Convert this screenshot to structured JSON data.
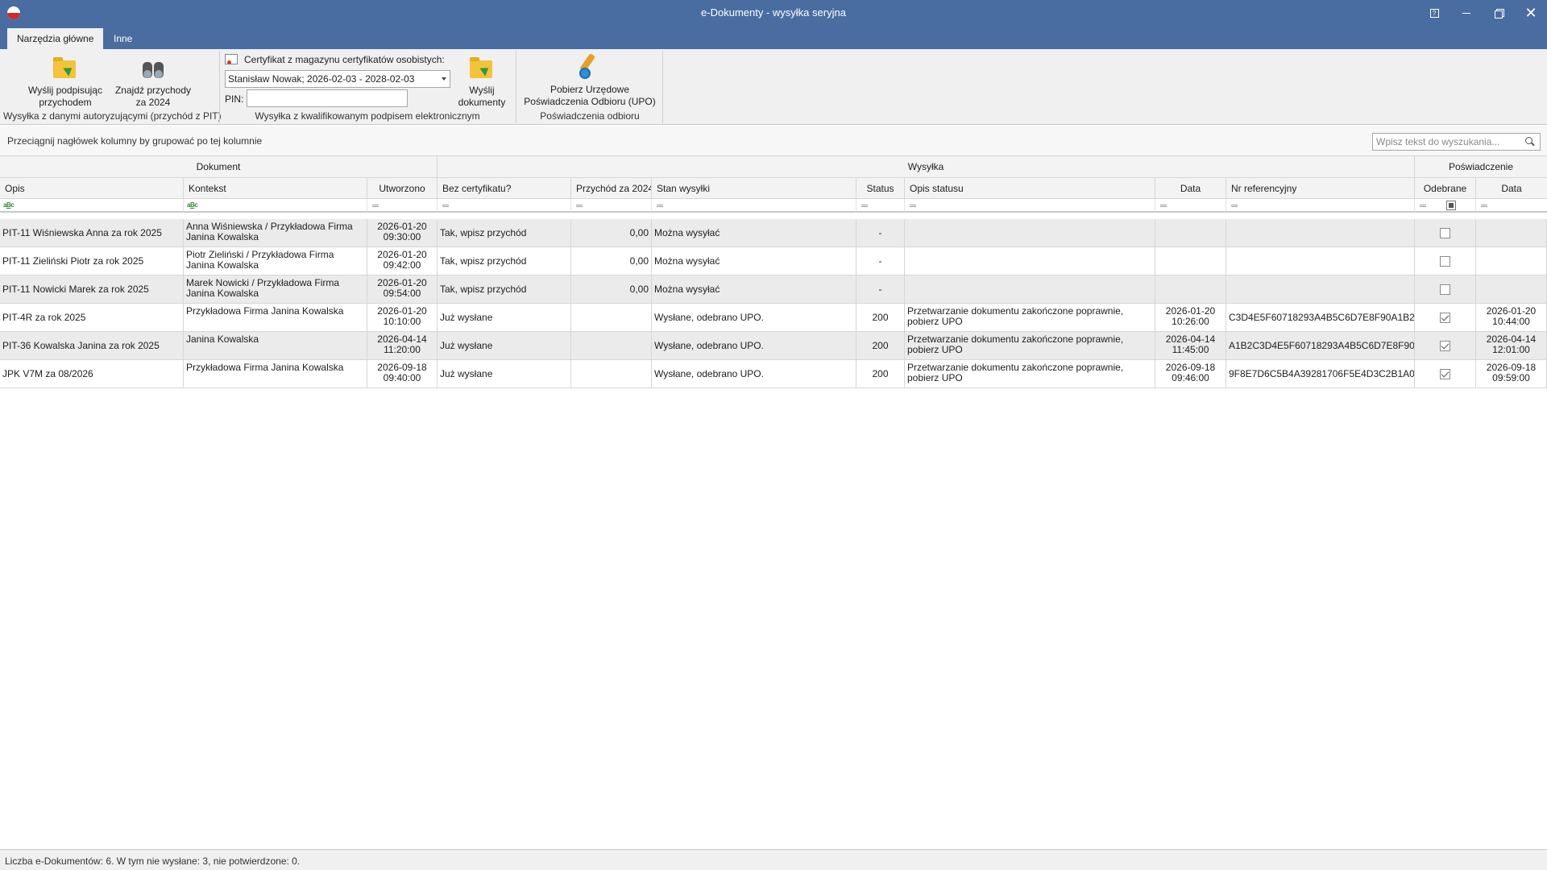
{
  "window": {
    "title": "e-Dokumenty - wysyłka seryjna",
    "help_label": "?",
    "close_label": "✕"
  },
  "tabs": [
    {
      "label": "Narzędzia główne"
    },
    {
      "label": "Inne"
    }
  ],
  "ribbon": {
    "btn_send_income_l1": "Wyślij podpisując",
    "btn_send_income_l2": "przychodem",
    "btn_find_income_l1": "Znajdź przychody",
    "btn_find_income_l2": "za 2024",
    "group1_label": "Wysyłka z danymi autoryzującymi (przychód z PIT)",
    "cert_label": "Certyfikat z magazynu certyfikatów osobistych:",
    "cert_value": "Stanisław Nowak; 2026-02-03 - 2028-02-03",
    "pin_label": "PIN:",
    "btn_send_docs_l1": "Wyślij",
    "btn_send_docs_l2": "dokumenty",
    "group2_label": "Wysyłka z kwalifikowanym podpisem elektronicznym",
    "btn_upo_l1": "Pobierz Urzędowe",
    "btn_upo_l2": "Poświadczenia Odbioru (UPO)",
    "group3_label": "Poświadczenia odbioru"
  },
  "groupbar": {
    "hint": "Przeciągnij nagłówek kolumny by grupować po tej kolumnie",
    "search_placeholder": "Wpisz tekst do wyszukania..."
  },
  "grid": {
    "bands": {
      "dokument": "Dokument",
      "wysylka": "Wysyłka",
      "poswiadczenie": "Poświadczenie"
    },
    "columns": {
      "opis": "Opis",
      "kontekst": "Kontekst",
      "utworzono": "Utworzono",
      "bez_cert": "Bez certyfikatu?",
      "przychod": "Przychód za 2024",
      "stan": "Stan wysyłki",
      "status": "Status",
      "opis_statusu": "Opis statusu",
      "data": "Data",
      "nr_ref": "Nr referencyjny",
      "odebrane": "Odebrane",
      "data_upo": "Data"
    },
    "rows": [
      {
        "opis": "PIT-11 Wiśniewska Anna za rok 2025",
        "kontekst": "Anna Wiśniewska / Przykładowa Firma Janina Kowalska",
        "utw_date": "2026-01-20",
        "utw_time": "09:30:00",
        "bez_cert": "Tak, wpisz przychód",
        "przychod": "0,00",
        "stan": "Można wysyłać",
        "status": "-",
        "opis_statusu": "",
        "data_date": "",
        "data_time": "",
        "nr_ref": "",
        "odebrane": false,
        "upo_date": "",
        "upo_time": ""
      },
      {
        "opis": "PIT-11 Zieliński Piotr za rok 2025",
        "kontekst": "Piotr Zieliński / Przykładowa Firma Janina Kowalska",
        "utw_date": "2026-01-20",
        "utw_time": "09:42:00",
        "bez_cert": "Tak, wpisz przychód",
        "przychod": "0,00",
        "stan": "Można wysyłać",
        "status": "-",
        "opis_statusu": "",
        "data_date": "",
        "data_time": "",
        "nr_ref": "",
        "odebrane": false,
        "upo_date": "",
        "upo_time": ""
      },
      {
        "opis": "PIT-11 Nowicki Marek za rok 2025",
        "kontekst": "Marek Nowicki / Przykładowa Firma Janina Kowalska",
        "utw_date": "2026-01-20",
        "utw_time": "09:54:00",
        "bez_cert": "Tak, wpisz przychód",
        "przychod": "0,00",
        "stan": "Można wysyłać",
        "status": "-",
        "opis_statusu": "",
        "data_date": "",
        "data_time": "",
        "nr_ref": "",
        "odebrane": false,
        "upo_date": "",
        "upo_time": ""
      },
      {
        "opis": "PIT-4R za rok 2025",
        "kontekst": "Przykładowa Firma Janina Kowalska",
        "utw_date": "2026-01-20",
        "utw_time": "10:10:00",
        "bez_cert": "Już wysłane",
        "przychod": "",
        "stan": "Wysłane, odebrano UPO.",
        "status": "200",
        "opis_statusu": "Przetwarzanie dokumentu zakończone poprawnie, pobierz UPO",
        "data_date": "2026-01-20",
        "data_time": "10:26:00",
        "nr_ref": "C3D4E5F60718293A4B5C6D7E8F90A1B2",
        "odebrane": true,
        "upo_date": "2026-01-20",
        "upo_time": "10:44:00"
      },
      {
        "opis": "PIT-36 Kowalska Janina za rok 2025",
        "kontekst": "Janina Kowalska",
        "utw_date": "2026-04-14",
        "utw_time": "11:20:00",
        "bez_cert": "Już wysłane",
        "przychod": "",
        "stan": "Wysłane, odebrano UPO.",
        "status": "200",
        "opis_statusu": "Przetwarzanie dokumentu zakończone poprawnie, pobierz UPO",
        "data_date": "2026-04-14",
        "data_time": "11:45:00",
        "nr_ref": "A1B2C3D4E5F60718293A4B5C6D7E8F90",
        "odebrane": true,
        "upo_date": "2026-04-14",
        "upo_time": "12:01:00"
      },
      {
        "opis": "JPK V7M za 08/2026",
        "kontekst": "Przykładowa Firma Janina Kowalska",
        "utw_date": "2026-09-18",
        "utw_time": "09:40:00",
        "bez_cert": "Już wysłane",
        "przychod": "",
        "stan": "Wysłane, odebrano UPO.",
        "status": "200",
        "opis_statusu": "Przetwarzanie dokumentu zakończone poprawnie, pobierz UPO",
        "data_date": "2026-09-18",
        "data_time": "09:46:00",
        "nr_ref": "9F8E7D6C5B4A39281706F5E4D3C2B1A0",
        "odebrane": true,
        "upo_date": "2026-09-18",
        "upo_time": "09:59:00"
      }
    ]
  },
  "statusbar": {
    "text": "Liczba e-Dokumentów: 6. W tym nie wysłane: 3, nie potwierdzone: 0."
  }
}
